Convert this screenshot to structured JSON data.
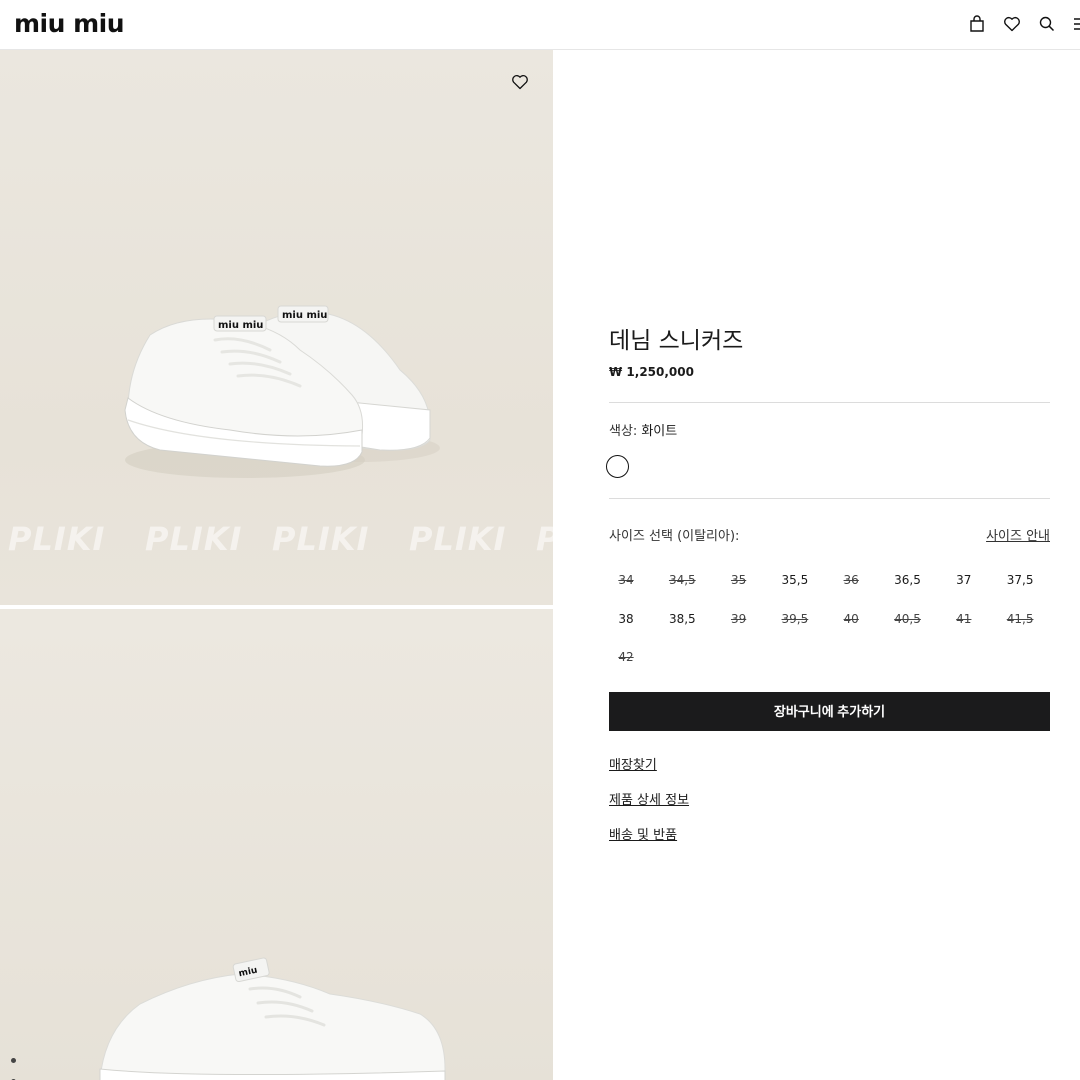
{
  "header": {
    "logo": "miu miu",
    "icons": [
      "bag-icon",
      "heart-icon",
      "search-icon",
      "menu-icon"
    ]
  },
  "gallery": {
    "watermark": [
      "PLIKI",
      "PLIKI",
      "PLIKI",
      "PLIKI",
      "P"
    ],
    "background_color": "#ebe6dd"
  },
  "product": {
    "title": "데님 스니커즈",
    "price": "₩ 1,250,000",
    "color_label": "색상:",
    "color_value": "화이트",
    "size_label": "사이즈 선택 (이탈리아):",
    "size_guide": "사이즈 안내",
    "sizes": [
      {
        "label": "34",
        "available": false
      },
      {
        "label": "34,5",
        "available": false
      },
      {
        "label": "35",
        "available": false
      },
      {
        "label": "35,5",
        "available": true
      },
      {
        "label": "36",
        "available": false
      },
      {
        "label": "36,5",
        "available": true
      },
      {
        "label": "37",
        "available": true
      },
      {
        "label": "37,5",
        "available": true
      },
      {
        "label": "38",
        "available": true
      },
      {
        "label": "38,5",
        "available": true
      },
      {
        "label": "39",
        "available": false
      },
      {
        "label": "39,5",
        "available": false
      },
      {
        "label": "40",
        "available": false
      },
      {
        "label": "40,5",
        "available": false
      },
      {
        "label": "41",
        "available": false
      },
      {
        "label": "41,5",
        "available": false
      },
      {
        "label": "42",
        "available": false
      }
    ],
    "add_to_cart": "장바구니에 추가하기",
    "links": {
      "store_finder": "매장찾기",
      "details": "제품 상세 정보",
      "shipping": "배송 및 반품"
    }
  },
  "colors": {
    "button_bg": "#1b1b1c",
    "divider": "#dcdcdc"
  }
}
